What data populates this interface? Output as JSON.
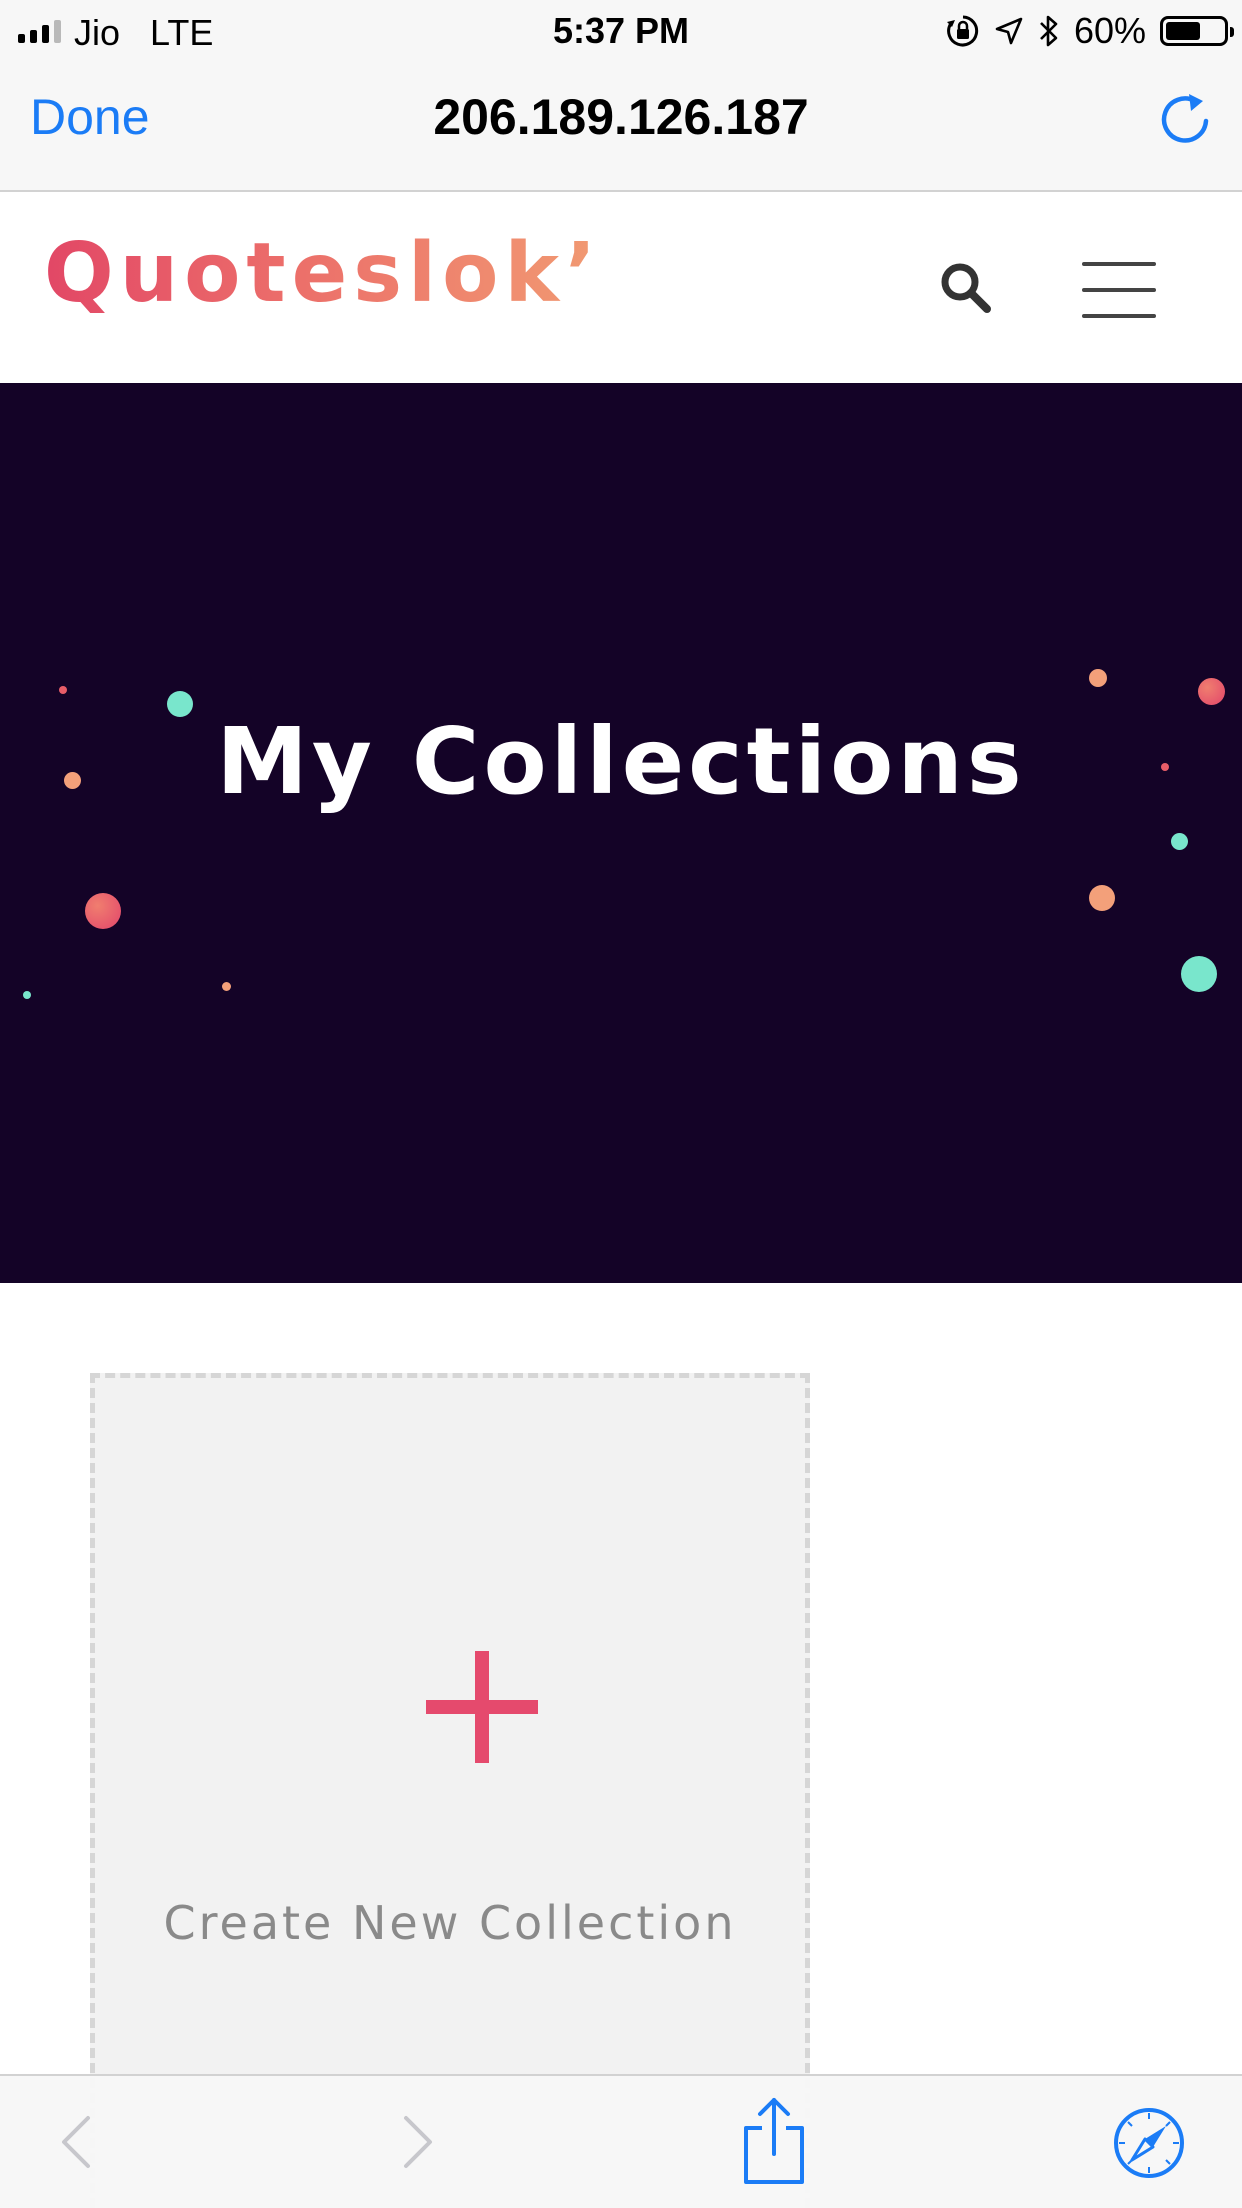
{
  "status_bar": {
    "carrier": "Jio",
    "network": "LTE",
    "time": "5:37 PM",
    "battery_percent_text": "60%",
    "battery_level": 0.6,
    "icons": [
      "signal-icon",
      "orientation-lock-icon",
      "location-arrow-icon",
      "bluetooth-icon",
      "battery-icon"
    ]
  },
  "browser": {
    "done_label": "Done",
    "url": "206.189.126.187",
    "accent_color": "#1b7cf6",
    "icons": [
      "reload-icon",
      "back-arrow-icon",
      "forward-arrow-icon",
      "share-icon",
      "safari-compass-icon"
    ]
  },
  "site": {
    "logo_text": "Quoteslok’",
    "brand_colors": [
      "#e24766",
      "#f19a72"
    ],
    "icons": [
      "search-icon",
      "hamburger-menu-icon"
    ]
  },
  "hero": {
    "title": "My Collections",
    "background_color": "#140327"
  },
  "collection_card": {
    "label": "Create New Collection",
    "icon": "plus-icon",
    "plus_color": "#e54a6d"
  }
}
